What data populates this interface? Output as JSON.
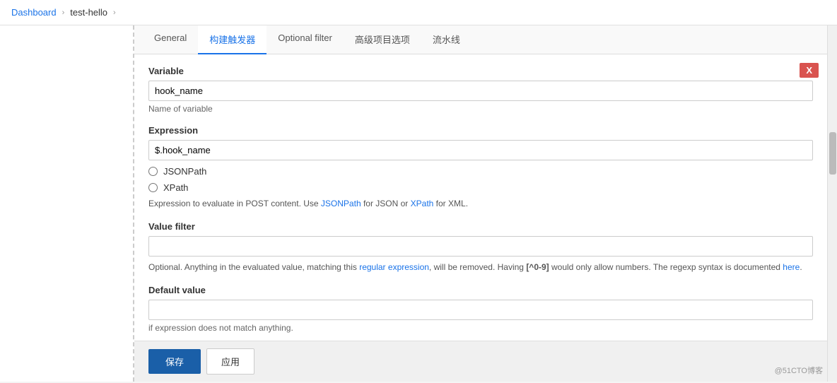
{
  "breadcrumb": {
    "home": "Dashboard",
    "separator1": "›",
    "page": "test-hello",
    "separator2": "›"
  },
  "tabs": [
    {
      "id": "general",
      "label": "General",
      "active": false
    },
    {
      "id": "build-trigger",
      "label": "构建触发器",
      "active": true
    },
    {
      "id": "optional-filter",
      "label": "Optional filter",
      "active": false
    },
    {
      "id": "advanced-options",
      "label": "高级项目选项",
      "active": false
    },
    {
      "id": "pipeline",
      "label": "流水线",
      "active": false
    }
  ],
  "delete_button_label": "X",
  "variable_section": {
    "label": "Variable",
    "input_value": "hook_name",
    "hint": "Name of variable"
  },
  "expression_section": {
    "label": "Expression",
    "input_value": "$.hook_name",
    "radio_options": [
      {
        "id": "jsonpath",
        "label": "JSONPath",
        "checked": false
      },
      {
        "id": "xpath",
        "label": "XPath",
        "checked": false
      }
    ],
    "hint_text": "Expression to evaluate in POST content. Use ",
    "hint_jsonpath": "JSONPath",
    "hint_mid": " for JSON or ",
    "hint_xpath": "XPath",
    "hint_end": " for XML."
  },
  "value_filter_section": {
    "label": "Value filter",
    "input_value": "",
    "hint_start": "Optional. Anything in the evaluated value, matching this ",
    "hint_link": "regular expression",
    "hint_mid": ", will be removed. Having ",
    "hint_bold": "[^0-9]",
    "hint_mid2": " would only allow numbers. The regexp syntax is documented ",
    "hint_link2": "here",
    "hint_end": "."
  },
  "default_value_section": {
    "label": "Default value",
    "input_value": "",
    "hint": "if expression does not match anything."
  },
  "buttons": {
    "save": "保存",
    "apply": "应用"
  },
  "watermark": "@51CTO博客"
}
